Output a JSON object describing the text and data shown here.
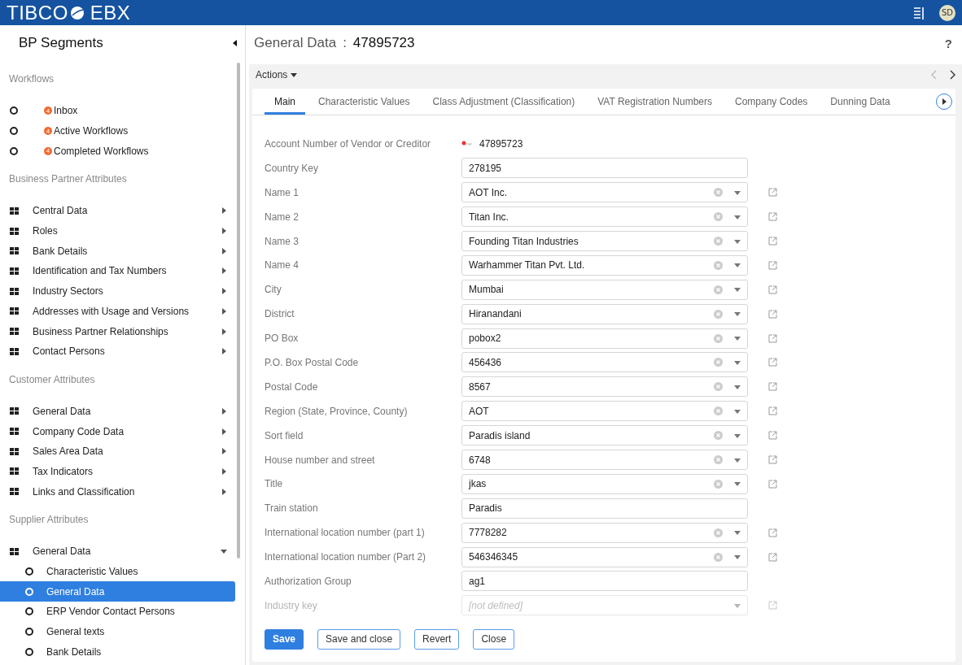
{
  "topbar": {
    "brand": "TIBCO",
    "product": "EBX",
    "avatar": "SD"
  },
  "sidebar": {
    "title": "BP Segments",
    "sections": [
      {
        "title": "Workflows",
        "items": [
          {
            "kind": "workflow",
            "label": "Inbox",
            "badge": "4"
          },
          {
            "kind": "workflow",
            "label": "Active Workflows",
            "badge": "4"
          },
          {
            "kind": "workflow",
            "label": "Completed Workflows",
            "badge": "4"
          }
        ]
      },
      {
        "title": "Business Partner Attributes",
        "items": [
          {
            "kind": "group",
            "label": "Central Data",
            "expanded": false
          },
          {
            "kind": "group",
            "label": "Roles",
            "expanded": false
          },
          {
            "kind": "group",
            "label": "Bank Details",
            "expanded": false
          },
          {
            "kind": "group",
            "label": "Identification and Tax Numbers",
            "expanded": false
          },
          {
            "kind": "group",
            "label": "Industry Sectors",
            "expanded": false
          },
          {
            "kind": "group",
            "label": "Addresses with Usage and Versions",
            "expanded": false
          },
          {
            "kind": "group",
            "label": "Business Partner Relationships",
            "expanded": false
          },
          {
            "kind": "group",
            "label": "Contact Persons",
            "expanded": false
          }
        ]
      },
      {
        "title": "Customer Attributes",
        "items": [
          {
            "kind": "group",
            "label": "General Data",
            "expanded": false
          },
          {
            "kind": "group",
            "label": "Company Code Data",
            "expanded": false
          },
          {
            "kind": "group",
            "label": "Sales Area Data",
            "expanded": false
          },
          {
            "kind": "group",
            "label": "Tax Indicators",
            "expanded": false
          },
          {
            "kind": "group",
            "label": "Links and Classification",
            "expanded": false
          }
        ]
      },
      {
        "title": "Supplier Attributes",
        "items": [
          {
            "kind": "group",
            "label": "General Data",
            "expanded": true,
            "children": [
              {
                "kind": "leaf",
                "label": "Characteristic Values",
                "selected": false
              },
              {
                "kind": "leaf",
                "label": "General Data",
                "selected": true
              },
              {
                "kind": "leaf",
                "label": "ERP Vendor Contact Persons",
                "selected": false
              },
              {
                "kind": "leaf",
                "label": "General texts",
                "selected": false
              },
              {
                "kind": "leaf",
                "label": "Bank Details",
                "selected": false
              }
            ]
          }
        ]
      }
    ]
  },
  "header": {
    "title": "General Data",
    "separator": ":",
    "record": "47895723",
    "help": "?"
  },
  "actions": {
    "label": "Actions"
  },
  "tabs": [
    {
      "label": "Main",
      "selected": true
    },
    {
      "label": "Characteristic Values",
      "selected": false
    },
    {
      "label": "Class Adjustment (Classification)",
      "selected": false
    },
    {
      "label": "VAT Registration Numbers",
      "selected": false
    },
    {
      "label": "Company Codes",
      "selected": false
    },
    {
      "label": "Dunning Data",
      "selected": false
    }
  ],
  "fields": [
    {
      "kind": "readonly",
      "label": "Account Number of Vendor or Creditor",
      "value": "47895723"
    },
    {
      "kind": "text",
      "label": "Country Key",
      "value": "278195"
    },
    {
      "kind": "select",
      "label": "Name 1",
      "value": "AOT Inc."
    },
    {
      "kind": "select",
      "label": "Name 2",
      "value": "Titan Inc."
    },
    {
      "kind": "select",
      "label": "Name 3",
      "value": "Founding Titan Industries"
    },
    {
      "kind": "select",
      "label": "Name 4",
      "value": "Warhammer Titan Pvt. Ltd."
    },
    {
      "kind": "select",
      "label": "City",
      "value": "Mumbai"
    },
    {
      "kind": "select",
      "label": "District",
      "value": "Hiranandani"
    },
    {
      "kind": "select",
      "label": "PO Box",
      "value": "pobox2"
    },
    {
      "kind": "select",
      "label": "P.O. Box Postal Code",
      "value": "456436"
    },
    {
      "kind": "select",
      "label": "Postal Code",
      "value": "8567"
    },
    {
      "kind": "select",
      "label": "Region (State, Province, County)",
      "value": "AOT"
    },
    {
      "kind": "select",
      "label": "Sort field",
      "value": "Paradis island"
    },
    {
      "kind": "select",
      "label": "House number and street",
      "value": "6748"
    },
    {
      "kind": "select",
      "label": "Title",
      "value": "jkas"
    },
    {
      "kind": "text",
      "label": "Train station",
      "value": "Paradis"
    },
    {
      "kind": "select",
      "label": "International location number (part 1)",
      "value": "7778282"
    },
    {
      "kind": "select",
      "label": "International location number (Part 2)",
      "value": "546346345"
    },
    {
      "kind": "text",
      "label": "Authorization Group",
      "value": "ag1"
    },
    {
      "kind": "undefined",
      "label": "Industry key",
      "placeholder": "[not defined]"
    }
  ],
  "buttons": [
    {
      "label": "Save",
      "primary": true
    },
    {
      "label": "Save and close",
      "primary": false
    },
    {
      "label": "Revert",
      "primary": false
    },
    {
      "label": "Close",
      "primary": false
    }
  ]
}
